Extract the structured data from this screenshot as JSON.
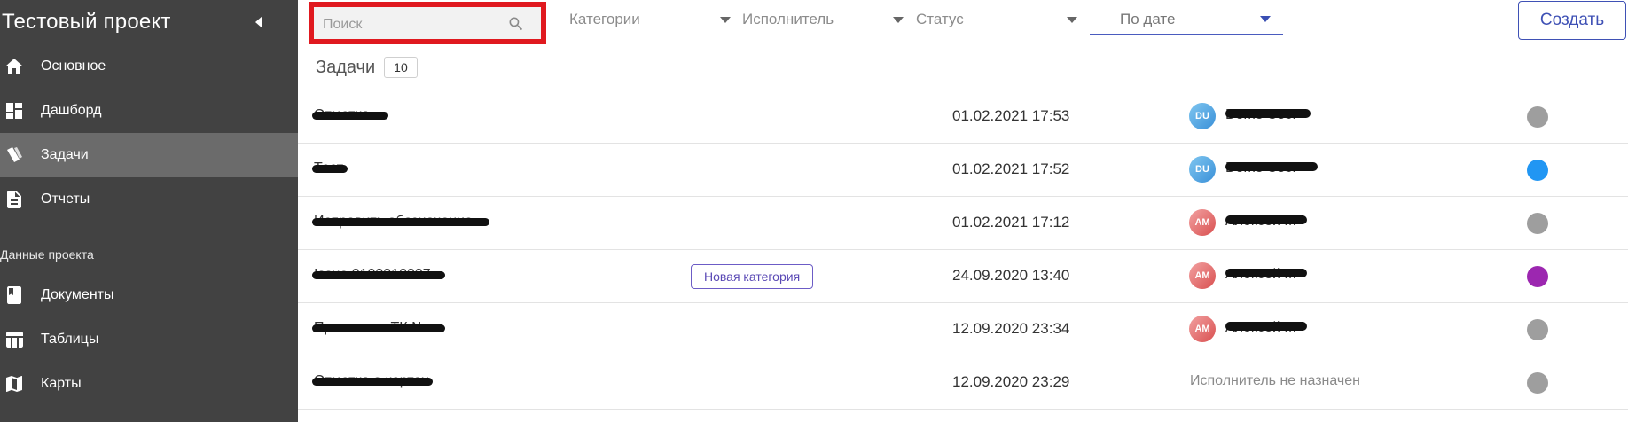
{
  "sidebar": {
    "project_title": "Тестовый проект",
    "items": [
      {
        "label": "Основное",
        "icon": "home-icon"
      },
      {
        "label": "Дашборд",
        "icon": "dashboard-icon"
      },
      {
        "label": "Задачи",
        "icon": "tasks-icon",
        "active": true
      },
      {
        "label": "Отчеты",
        "icon": "report-icon"
      }
    ],
    "section_label": "Данные проекта",
    "data_items": [
      {
        "label": "Документы",
        "icon": "book-icon"
      },
      {
        "label": "Таблицы",
        "icon": "table-icon"
      },
      {
        "label": "Карты",
        "icon": "map-icon"
      }
    ]
  },
  "toolbar": {
    "search_placeholder": "Поиск",
    "filter_categories": "Категории",
    "filter_assignee": "Исполнитель",
    "filter_status": "Статус",
    "sort_by": "По дате",
    "create_label": "Создать"
  },
  "tasks": {
    "title": "Задачи",
    "count": "10",
    "rows": [
      {
        "name": "Отметка",
        "category": "",
        "date": "01.02.2021 17:53",
        "avatar": "DU",
        "avatar_type": "du",
        "assignee": "Demo User",
        "status_color": "#9e9e9e"
      },
      {
        "name": "Тест",
        "category": "",
        "date": "01.02.2021 17:52",
        "avatar": "DU",
        "avatar_type": "du",
        "assignee": "Demo User",
        "status_color": "#2196f3"
      },
      {
        "name": "Исправить обозначение",
        "category": "",
        "date": "01.02.2021 17:12",
        "avatar": "AM",
        "avatar_type": "am",
        "assignee": "Алексей М",
        "status_color": "#9e9e9e"
      },
      {
        "name": "Issue 2103312337",
        "category": "Новая категория",
        "date": "24.09.2020 13:40",
        "avatar": "AM",
        "avatar_type": "am",
        "assignee": "Алексей М",
        "status_color": "#9c27b0"
      },
      {
        "name": "Протечка в ТК №.",
        "category": "",
        "date": "12.09.2020 23:34",
        "avatar": "AM",
        "avatar_type": "am",
        "assignee": "Алексей М",
        "status_color": "#9e9e9e"
      },
      {
        "name": "Отметка о картах",
        "category": "",
        "date": "12.09.2020 23:29",
        "avatar": "",
        "avatar_type": "",
        "assignee": "Исполнитель не назначен",
        "status_color": "#9e9e9e"
      }
    ]
  }
}
